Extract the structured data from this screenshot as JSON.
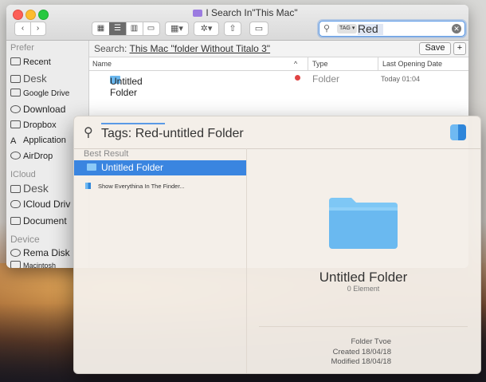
{
  "finder": {
    "title": "I Search In\"This Mac\"",
    "search": {
      "tag_label": "TAG ▾",
      "value": "Red"
    },
    "sidebar": {
      "favorites_header": "Prefer",
      "favorites": [
        "Recent",
        "Desk",
        "Google Drive",
        "Download",
        "Dropbox",
        "Application",
        "AirDrop"
      ],
      "icloud_header": "ICloud",
      "icloud": [
        "Desk",
        "ICloud Driv",
        "Document"
      ],
      "devices_header": "Device",
      "devices": [
        "Rema Disk",
        "Macintosh"
      ]
    },
    "scope": {
      "prefix": "Search:",
      "value": "This Mac \"folder Without Titalo 3\"",
      "save_label": "Save",
      "plus_label": "+"
    },
    "columns": {
      "name": "Name",
      "type": "Type",
      "last_opened": "Last Opening Date"
    },
    "row": {
      "name": "Untitled Folder",
      "type": "Folder",
      "date": "Today 01:04"
    }
  },
  "spotlight": {
    "query": "Tags: Red-untitled Folder",
    "section": "Best Result",
    "selected_item": "Untitled Folder",
    "second_item": "Show Everythina In The Finder...",
    "preview": {
      "title": "Untitled Folder",
      "subtitle": "0 Element",
      "type_line": "Folder Tvoe",
      "created": "Created 18/04/18",
      "modified": "Modified 18/04/18"
    }
  },
  "colors": {
    "selection": "#3a85e0",
    "folder": "#6ab7ee",
    "tag_red": "#e04343"
  }
}
